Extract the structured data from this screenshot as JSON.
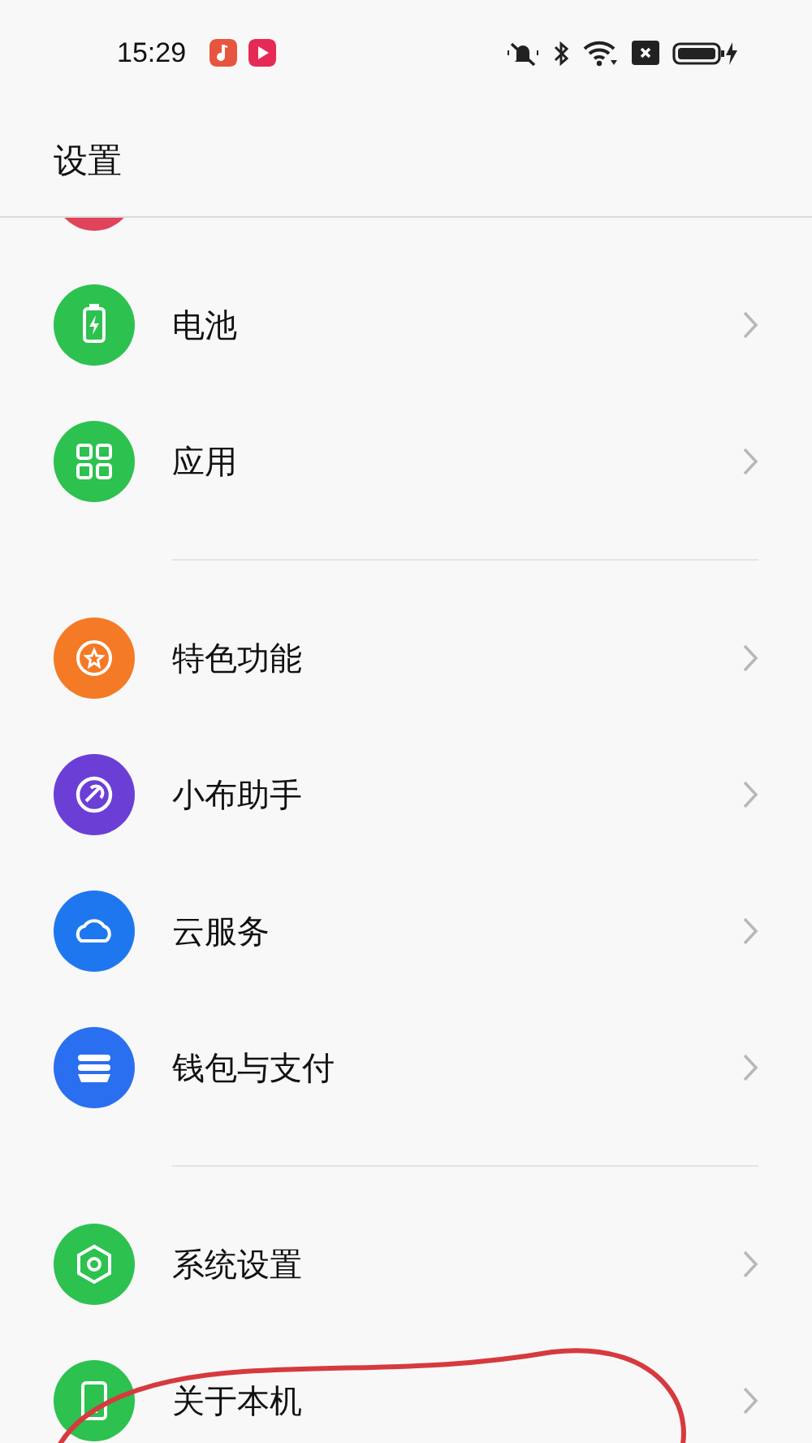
{
  "status_bar": {
    "time": "15:29",
    "notifications": [
      {
        "color": "#e8553f"
      },
      {
        "color": "#e52a55"
      }
    ]
  },
  "header": {
    "title": "设置"
  },
  "groups": [
    {
      "items": [
        {
          "kind": "clipped",
          "color": "#e0435a"
        },
        {
          "kind": "row",
          "label": "电池",
          "color": "#2dc150",
          "circled": false
        },
        {
          "kind": "row",
          "label": "应用",
          "color": "#2dc150",
          "circled": false
        }
      ]
    },
    {
      "items": [
        {
          "kind": "row",
          "label": "特色功能",
          "color": "#f47a26",
          "circled": false
        },
        {
          "kind": "row",
          "label": "小布助手",
          "color": "#6b3fd6",
          "circled": false
        },
        {
          "kind": "row",
          "label": "云服务",
          "color": "#1f77ef",
          "circled": false
        },
        {
          "kind": "row",
          "label": "钱包与支付",
          "color": "#2a6ff0",
          "circled": false
        }
      ]
    },
    {
      "items": [
        {
          "kind": "row",
          "label": "系统设置",
          "color": "#2dc150",
          "circled": false
        },
        {
          "kind": "row",
          "label": "关于本机",
          "color": "#2dc150",
          "circled": true
        }
      ]
    }
  ]
}
